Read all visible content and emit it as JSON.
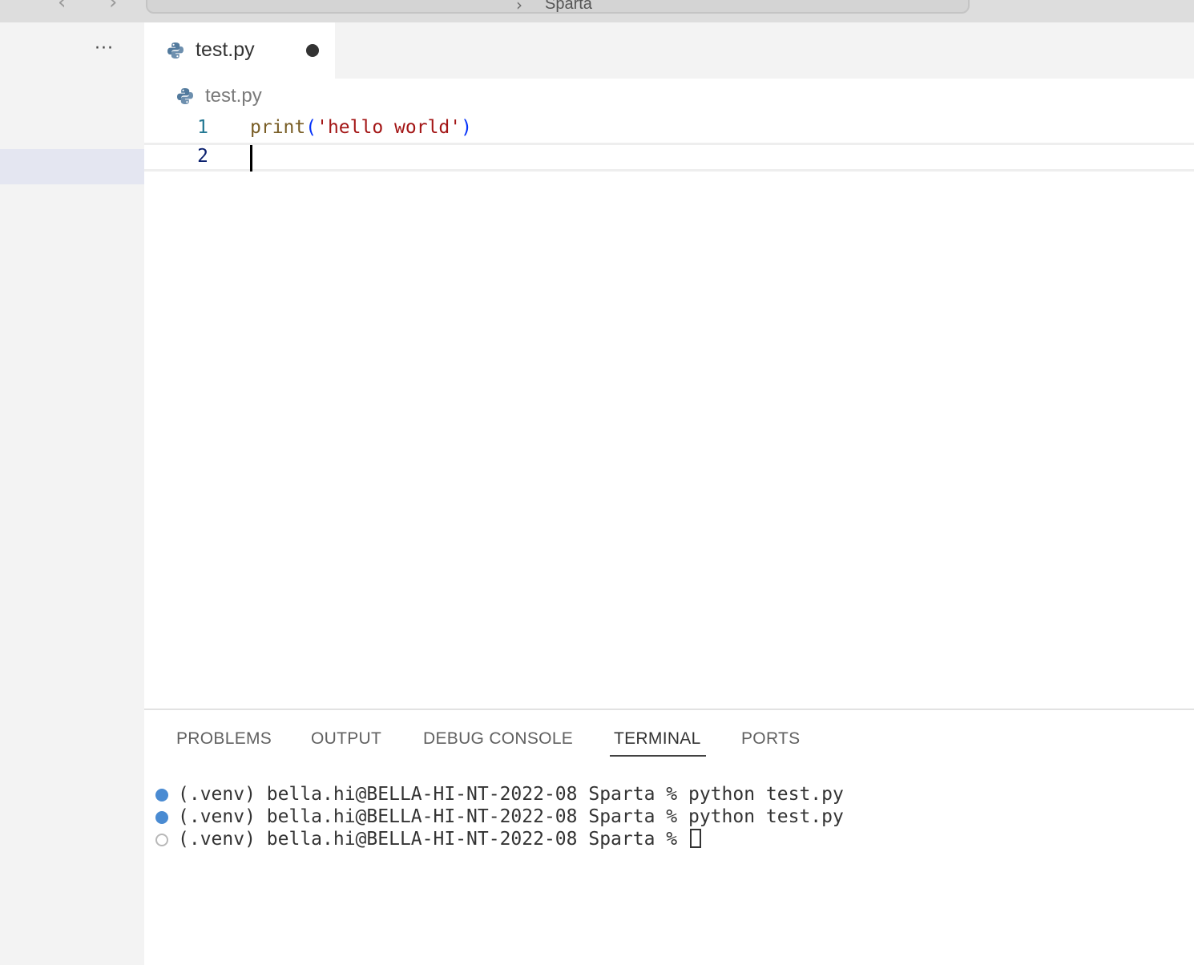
{
  "titlebar": {
    "back_icon": "chevron-left-icon",
    "forward_icon": "chevron-right-icon",
    "command_center_text": "Sparta"
  },
  "sidebar": {
    "more_actions_icon": "ellipsis-icon"
  },
  "tabs": [
    {
      "label": "test.py",
      "icon": "python-file-icon",
      "modified": true
    }
  ],
  "breadcrumb": {
    "file": "test.py",
    "icon": "python-file-icon"
  },
  "editor": {
    "lines": [
      {
        "number": "1",
        "tokens": {
          "fn": "print",
          "open": "(",
          "str": "'hello world'",
          "close": ")"
        }
      },
      {
        "number": "2",
        "text": ""
      }
    ],
    "colors": {
      "function": "#795e26",
      "bracket": "#0431fa",
      "string": "#a31515",
      "line_number": "#237893",
      "active_line_number": "#0b216f"
    }
  },
  "panel": {
    "tabs": [
      "PROBLEMS",
      "OUTPUT",
      "DEBUG CONSOLE",
      "TERMINAL",
      "PORTS"
    ],
    "active_tab": "TERMINAL",
    "terminal_lines": [
      {
        "text": "(.venv) bella.hi@BELLA-HI-NT-2022-08 Sparta % python test.py",
        "status": "success"
      },
      {
        "text": "(.venv) bella.hi@BELLA-HI-NT-2022-08 Sparta % python test.py",
        "status": "success"
      },
      {
        "text": "(.venv) bella.hi@BELLA-HI-NT-2022-08 Sparta % ",
        "status": "pending"
      }
    ],
    "status_color": "#4a8bd2"
  }
}
